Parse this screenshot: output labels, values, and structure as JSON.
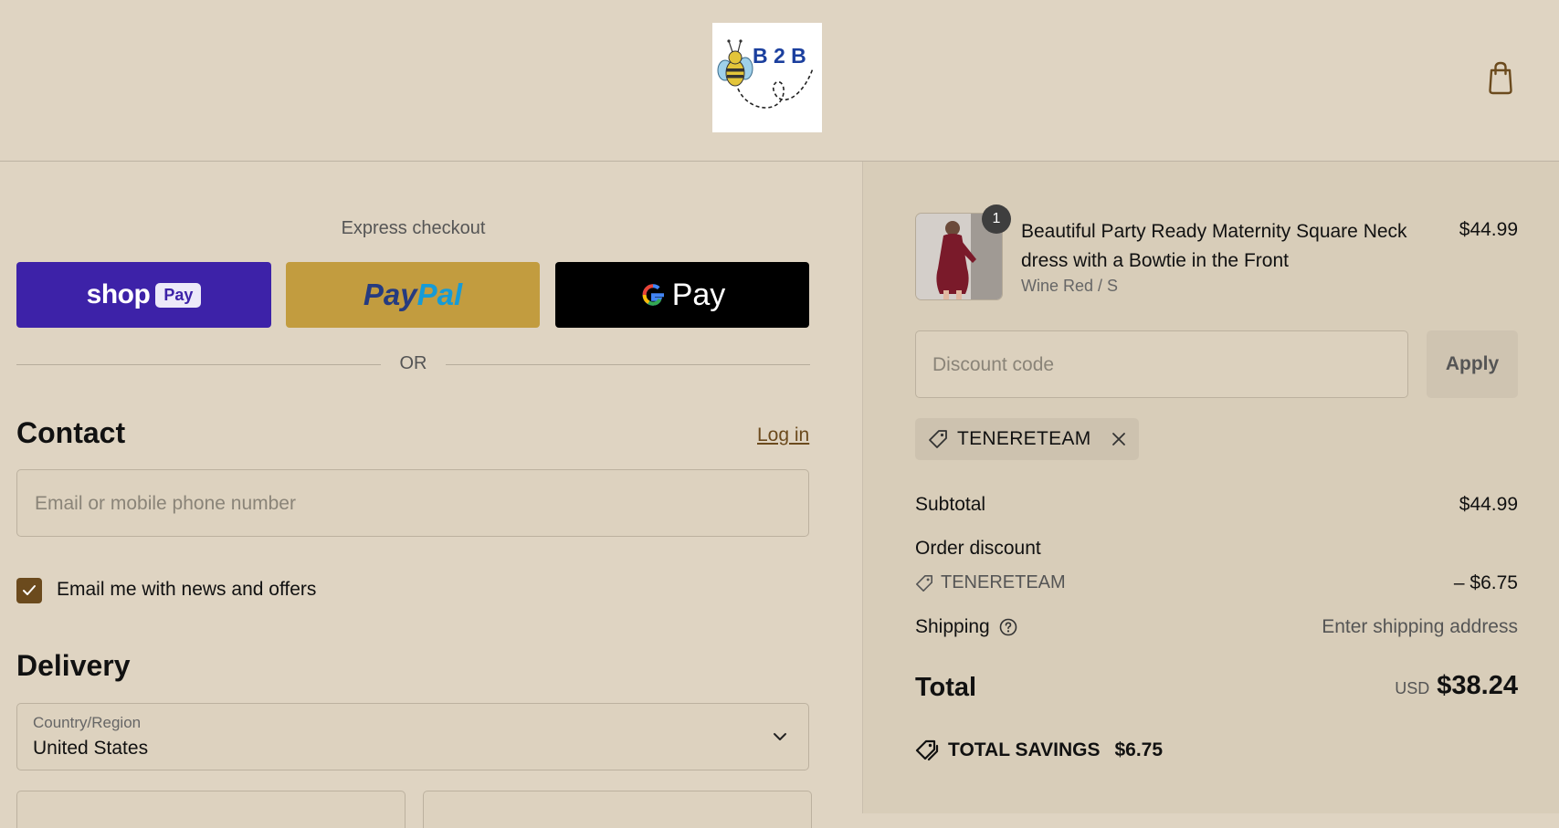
{
  "header": {
    "logo_text": "B 2 B",
    "cart_icon": "shopping-bag-icon"
  },
  "express": {
    "title": "Express checkout",
    "shop_pay": {
      "word": "shop",
      "chip": "Pay"
    },
    "paypal": {
      "part1": "Pay",
      "part2": "Pal"
    },
    "gpay": {
      "word": "Pay"
    },
    "or_label": "OR"
  },
  "contact": {
    "title": "Contact",
    "login_label": "Log in",
    "email_placeholder": "Email or mobile phone number",
    "newsletter_label": "Email me with news and offers",
    "newsletter_checked": true
  },
  "delivery": {
    "title": "Delivery",
    "country_label": "Country/Region",
    "country_value": "United States"
  },
  "order": {
    "quantity": "1",
    "product_title": "Beautiful Party Ready Maternity Square Neck dress with a Bowtie in the Front",
    "variant": "Wine Red / S",
    "price": "$44.99",
    "discount_placeholder": "Discount code",
    "apply_label": "Apply",
    "applied_code": "TENERETEAM"
  },
  "summary": {
    "subtotal_label": "Subtotal",
    "subtotal_value": "$44.99",
    "order_discount_label": "Order discount",
    "discount_code": "TENERETEAM",
    "discount_value": "– $6.75",
    "shipping_label": "Shipping",
    "shipping_value": "Enter shipping address",
    "total_label": "Total",
    "currency": "USD",
    "total_value": "$38.24",
    "savings_label": "TOTAL SAVINGS",
    "savings_value": "$6.75"
  },
  "colors": {
    "background": "#dfd4c2",
    "summary_background": "#d8cdb9",
    "shop_pay": "#3d22a8",
    "paypal": "#c29c3f",
    "gpay": "#000000",
    "accent": "#6b4a1d"
  }
}
